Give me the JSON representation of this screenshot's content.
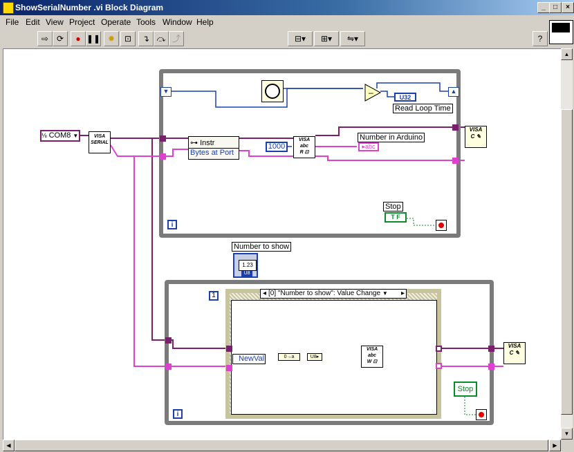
{
  "window": {
    "title": "ShowSerialNumber .vi Block Diagram"
  },
  "menu": [
    "File",
    "Edit",
    "View",
    "Project",
    "Operate",
    "Tools",
    "Window",
    "Help"
  ],
  "toolbar": {
    "font": "13pt Application Font"
  },
  "diagram": {
    "com_port": "COM8",
    "visa_serial": "VISA\nSERIAL",
    "property_instr": "Instr",
    "property_bytes": "Bytes at Port",
    "read_count": "1000",
    "number_in_arduino": "Number in Arduino",
    "read_loop_time": "Read Loop Time",
    "u32": "U32",
    "abc": "abc",
    "stop_label_top": "Stop",
    "tf": "T F",
    "number_to_show": "Number to show",
    "numeric_value": "1.23",
    "u8": "U8",
    "timeout_const": "1",
    "event_case": "[0] \"Number to show\": Value Change",
    "newval": "NewVal",
    "stop_label_bottom": "Stop",
    "iter_top": "i",
    "iter_bottom": "i",
    "visa_close": "VISA"
  }
}
